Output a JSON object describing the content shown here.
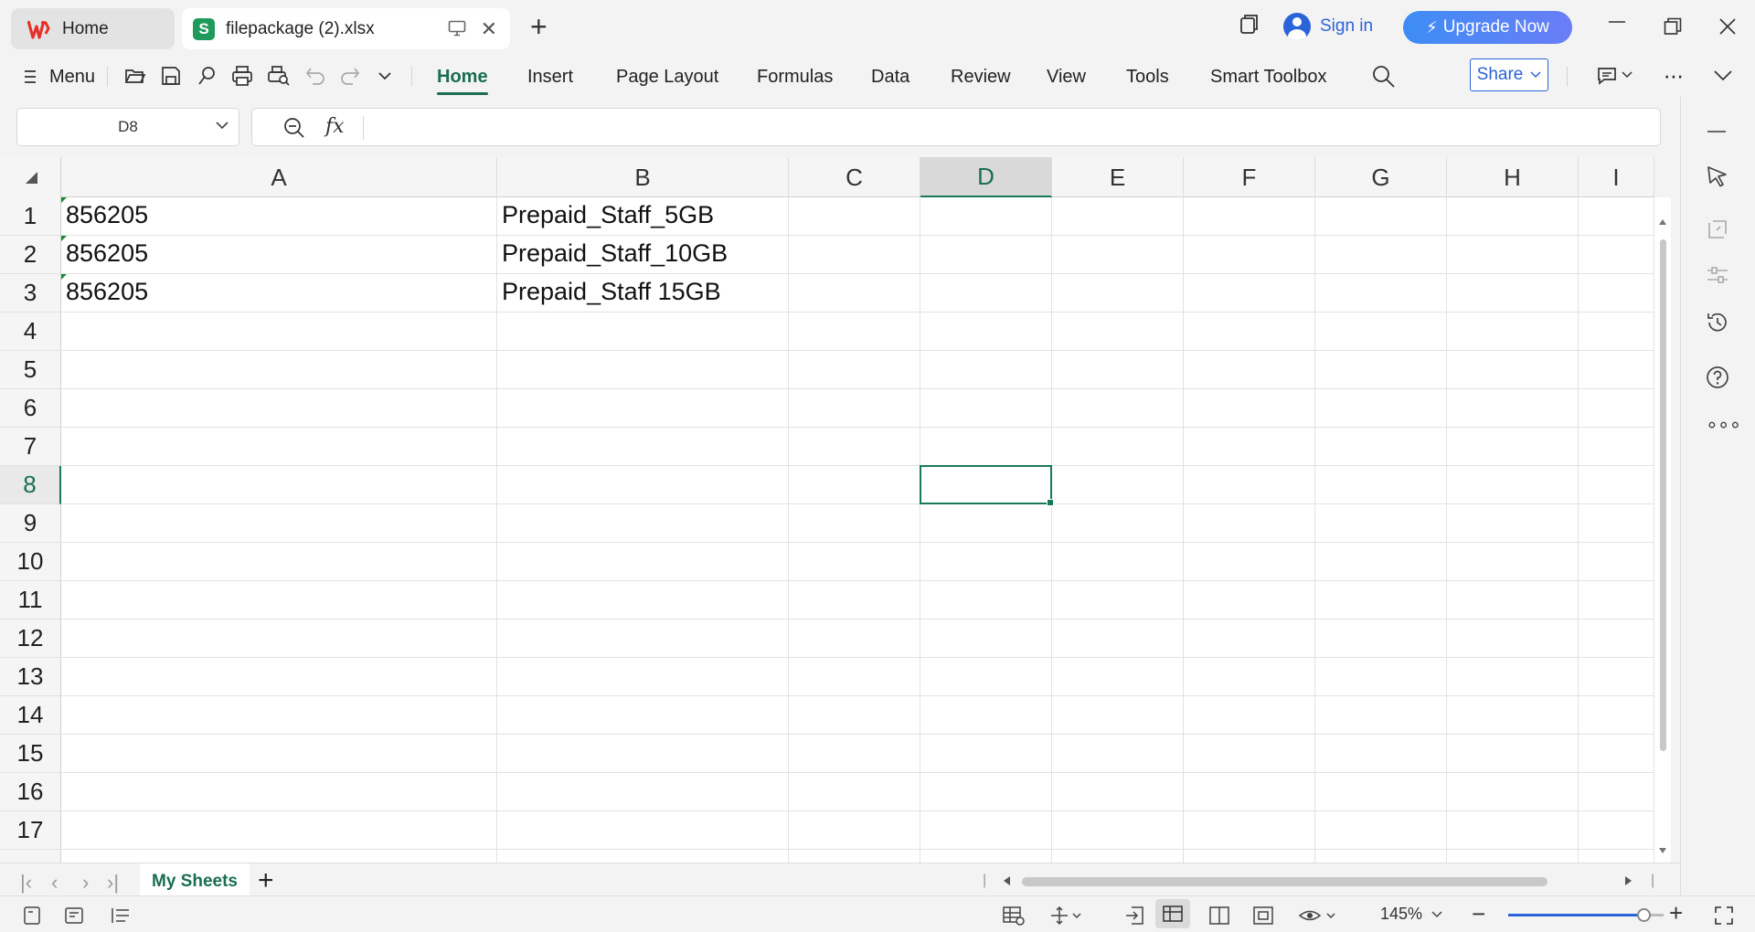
{
  "titlebar": {
    "home_tab": "Home",
    "file_tab": "filepackage (2).xlsx",
    "sign_in": "Sign in",
    "upgrade": "Upgrade Now"
  },
  "ribbon": {
    "menu": "Menu",
    "tabs": [
      "Home",
      "Insert",
      "Page Layout",
      "Formulas",
      "Data",
      "Review",
      "View",
      "Tools",
      "Smart Toolbox"
    ],
    "active_tab": "Home",
    "share": "Share"
  },
  "formula_bar": {
    "name_box": "D8",
    "fx": "fx",
    "content": ""
  },
  "grid": {
    "columns": [
      "A",
      "B",
      "C",
      "D",
      "E",
      "F",
      "G",
      "H",
      "I"
    ],
    "selected_column": "D",
    "rows": [
      "1",
      "2",
      "3",
      "4",
      "5",
      "6",
      "7",
      "8",
      "9",
      "10",
      "11",
      "12",
      "13",
      "14",
      "15",
      "16",
      "17"
    ],
    "selected_row": "8",
    "cells": [
      {
        "ref": "A1",
        "value": "856205"
      },
      {
        "ref": "B1",
        "value": "Prepaid_Staff_5GB"
      },
      {
        "ref": "A2",
        "value": "856205"
      },
      {
        "ref": "B2",
        "value": "Prepaid_Staff_10GB"
      },
      {
        "ref": "A3",
        "value": "856205"
      },
      {
        "ref": "B3",
        "value": "Prepaid_Staff 15GB"
      }
    ]
  },
  "sheet_tabs": {
    "active": "My Sheets"
  },
  "status_bar": {
    "zoom": "145%",
    "zoom_level": 0.87
  },
  "colors": {
    "accent": "#1a6e52",
    "link_blue": "#2b63d9",
    "upgrade_gradient_start": "#3d8df5",
    "upgrade_gradient_end": "#6a7df7"
  }
}
